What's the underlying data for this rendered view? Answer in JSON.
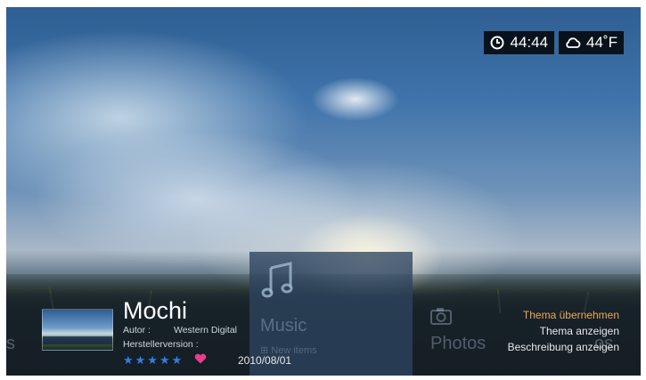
{
  "status": {
    "time": "44:44",
    "temperature": "44˚F",
    "clock_icon": "clock-icon",
    "weather_icon": "cloud-icon"
  },
  "menu": {
    "left_partial": "s",
    "music_label": "Music",
    "music_sub": "⊞ New items",
    "photos_label": "Photos",
    "right_partial": "os"
  },
  "theme": {
    "name": "Mochi",
    "author_label": "Autor :",
    "author_value": "Western Digital",
    "version_label": "Herstellerversion :",
    "rating": "★★★★★",
    "rating_value": 5,
    "date": "2010/08/01"
  },
  "actions": {
    "apply": "Thema übernehmen",
    "show": "Thema anzeigen",
    "describe": "Beschreibung anzeigen"
  },
  "colors": {
    "highlight": "#f0a65a",
    "stars": "#2e7fe0",
    "heart": "#e83e8c"
  }
}
